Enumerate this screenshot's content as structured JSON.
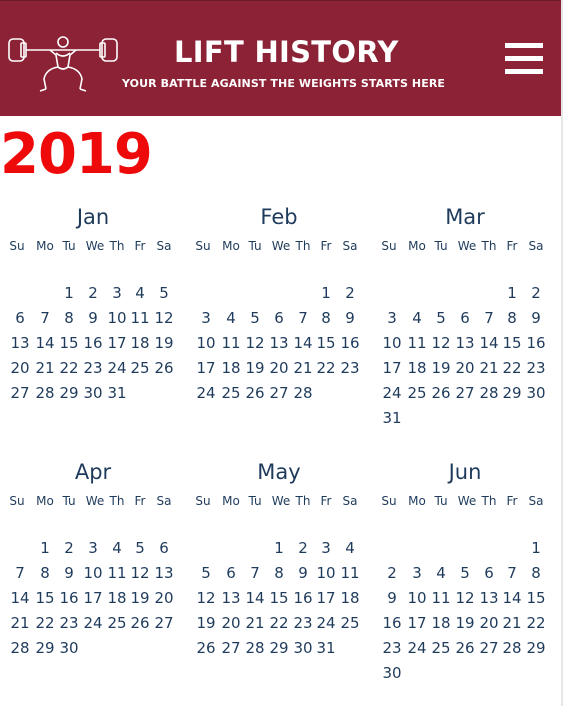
{
  "header": {
    "title": "LIFT HISTORY",
    "subtitle": "YOUR BATTLE AGAINST THE WEIGHTS STARTS HERE",
    "logo_icon": "weightlifter-logo-icon",
    "menu_icon": "hamburger-menu-icon",
    "background_color": "#8c2236"
  },
  "year": "2019",
  "year_color": "#ee0a0a",
  "weekday_labels": [
    "Su",
    "Mo",
    "Tu",
    "We",
    "Th",
    "Fr",
    "Sa"
  ],
  "months": [
    {
      "name": "Jan",
      "weeks": [
        [
          "",
          "",
          "1",
          "2",
          "3",
          "4",
          "5"
        ],
        [
          "6",
          "7",
          "8",
          "9",
          "10",
          "11",
          "12"
        ],
        [
          "13",
          "14",
          "15",
          "16",
          "17",
          "18",
          "19"
        ],
        [
          "20",
          "21",
          "22",
          "23",
          "24",
          "25",
          "26"
        ],
        [
          "27",
          "28",
          "29",
          "30",
          "31",
          "",
          ""
        ]
      ]
    },
    {
      "name": "Feb",
      "weeks": [
        [
          "",
          "",
          "",
          "",
          "",
          "1",
          "2"
        ],
        [
          "3",
          "4",
          "5",
          "6",
          "7",
          "8",
          "9"
        ],
        [
          "10",
          "11",
          "12",
          "13",
          "14",
          "15",
          "16"
        ],
        [
          "17",
          "18",
          "19",
          "20",
          "21",
          "22",
          "23"
        ],
        [
          "24",
          "25",
          "26",
          "27",
          "28",
          "",
          ""
        ]
      ]
    },
    {
      "name": "Mar",
      "weeks": [
        [
          "",
          "",
          "",
          "",
          "",
          "1",
          "2"
        ],
        [
          "3",
          "4",
          "5",
          "6",
          "7",
          "8",
          "9"
        ],
        [
          "10",
          "11",
          "12",
          "13",
          "14",
          "15",
          "16"
        ],
        [
          "17",
          "18",
          "19",
          "20",
          "21",
          "22",
          "23"
        ],
        [
          "24",
          "25",
          "26",
          "27",
          "28",
          "29",
          "30"
        ],
        [
          "31",
          "",
          "",
          "",
          "",
          "",
          ""
        ]
      ]
    },
    {
      "name": "Apr",
      "weeks": [
        [
          "",
          "1",
          "2",
          "3",
          "4",
          "5",
          "6"
        ],
        [
          "7",
          "8",
          "9",
          "10",
          "11",
          "12",
          "13"
        ],
        [
          "14",
          "15",
          "16",
          "17",
          "18",
          "19",
          "20"
        ],
        [
          "21",
          "22",
          "23",
          "24",
          "25",
          "26",
          "27"
        ],
        [
          "28",
          "29",
          "30",
          "",
          "",
          "",
          ""
        ]
      ]
    },
    {
      "name": "May",
      "weeks": [
        [
          "",
          "",
          "",
          "1",
          "2",
          "3",
          "4"
        ],
        [
          "5",
          "6",
          "7",
          "8",
          "9",
          "10",
          "11"
        ],
        [
          "12",
          "13",
          "14",
          "15",
          "16",
          "17",
          "18"
        ],
        [
          "19",
          "20",
          "21",
          "22",
          "23",
          "24",
          "25"
        ],
        [
          "26",
          "27",
          "28",
          "29",
          "30",
          "31",
          ""
        ]
      ]
    },
    {
      "name": "Jun",
      "weeks": [
        [
          "",
          "",
          "",
          "",
          "",
          "",
          "1"
        ],
        [
          "2",
          "3",
          "4",
          "5",
          "6",
          "7",
          "8"
        ],
        [
          "9",
          "10",
          "11",
          "12",
          "13",
          "14",
          "15"
        ],
        [
          "16",
          "17",
          "18",
          "19",
          "20",
          "21",
          "22"
        ],
        [
          "23",
          "24",
          "25",
          "26",
          "27",
          "28",
          "29"
        ],
        [
          "30",
          "",
          "",
          "",
          "",
          "",
          ""
        ]
      ]
    }
  ]
}
